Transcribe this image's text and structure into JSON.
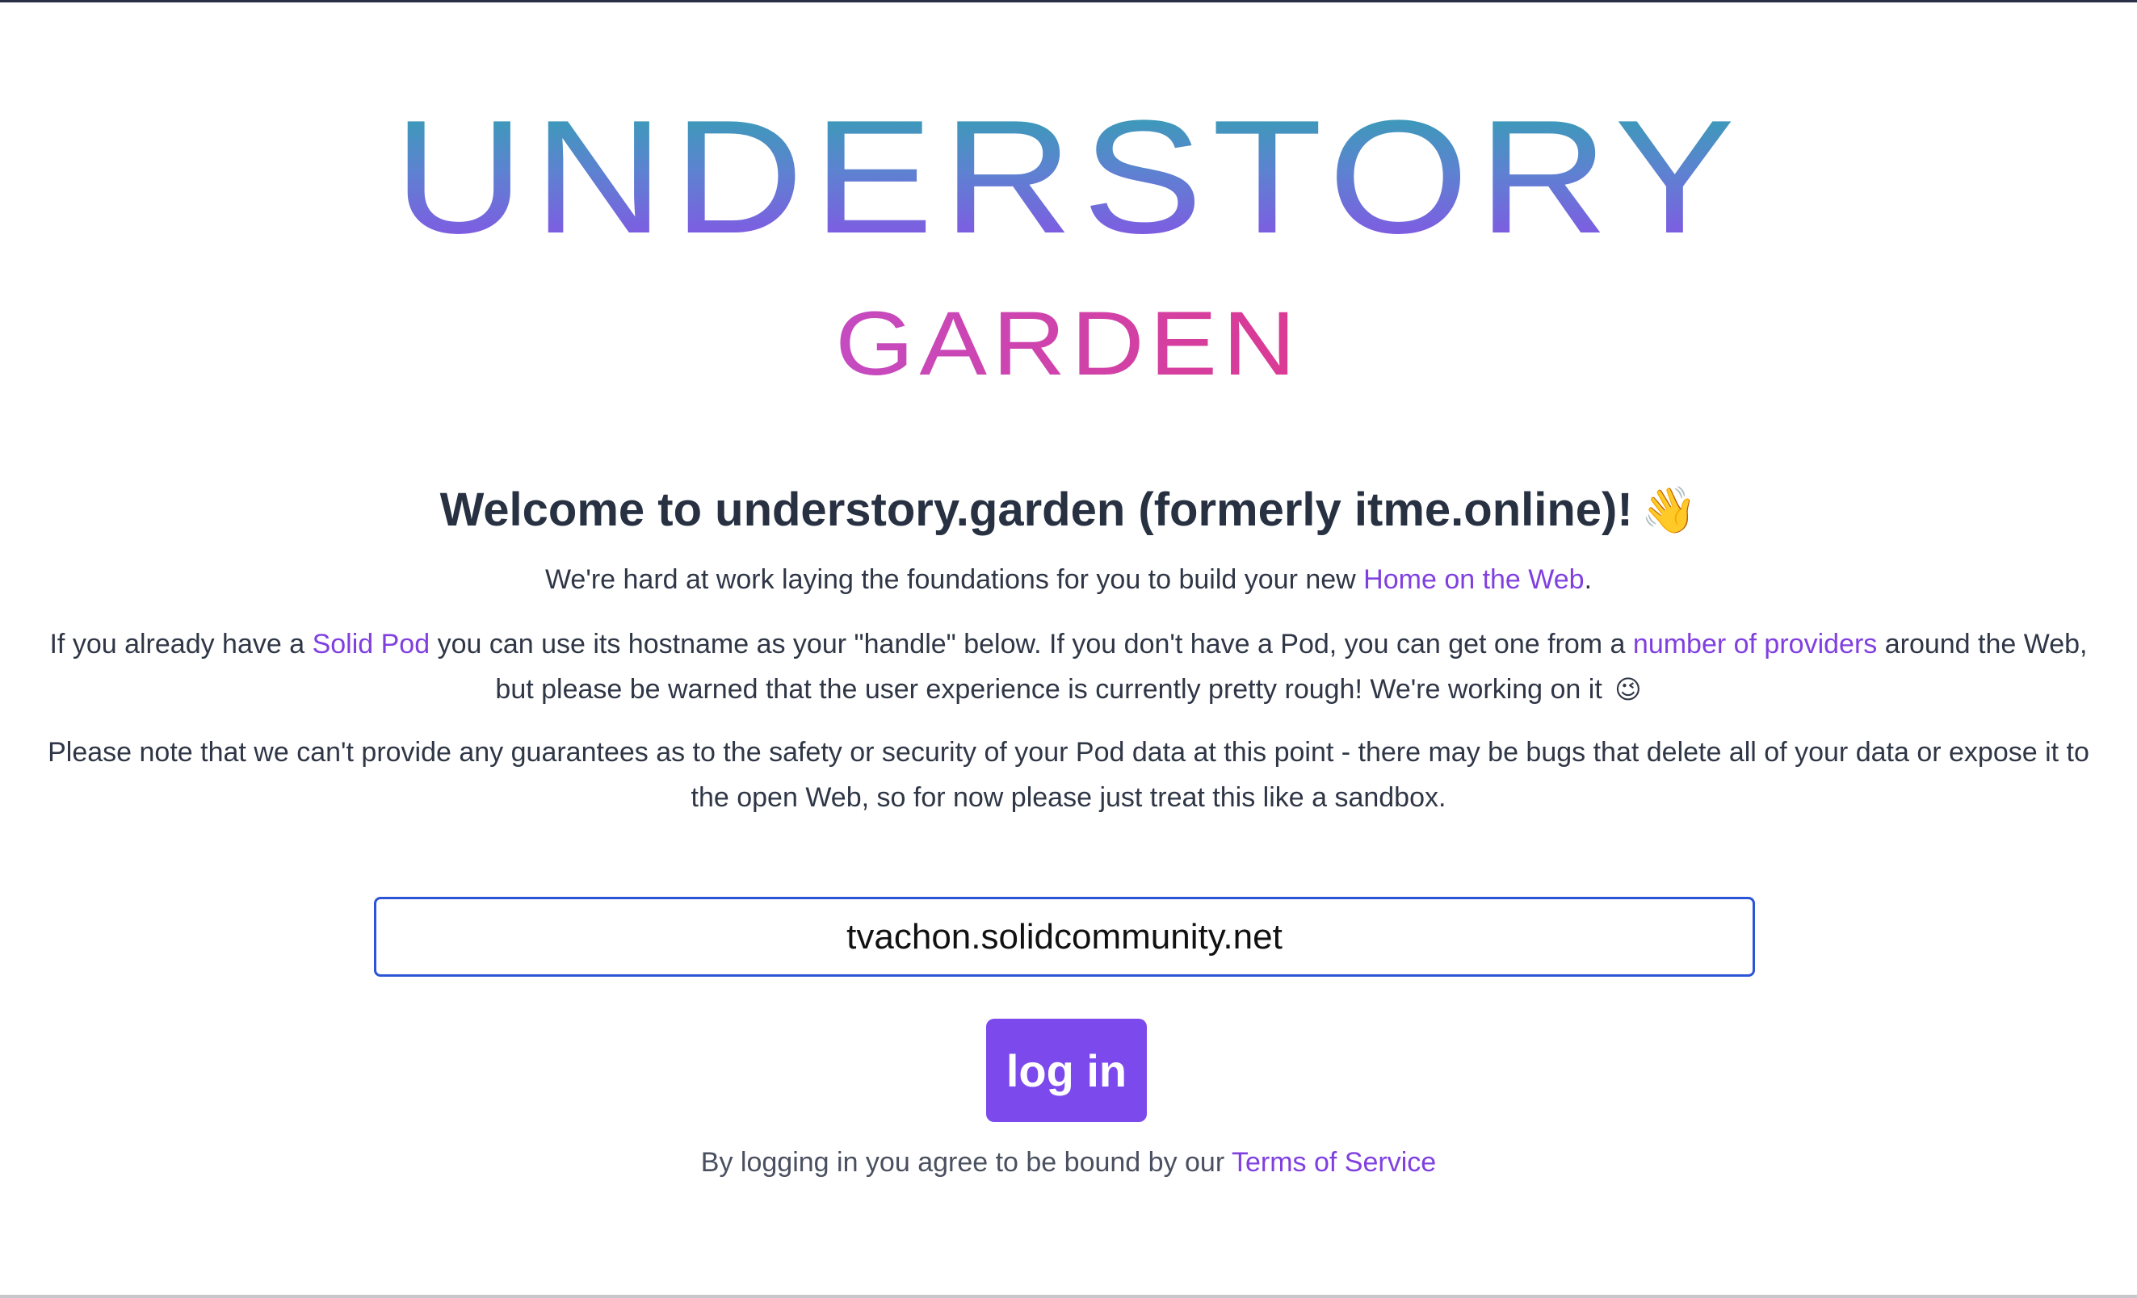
{
  "logo": {
    "title": "UNDERSTORY",
    "subtitle": "GARDEN"
  },
  "welcome": {
    "heading": "Welcome to understory.garden (formerly itme.online)!",
    "icon": "👋"
  },
  "intro": {
    "text_before": "We're hard at work laying the foundations for you to build your new ",
    "link": "Home on the Web",
    "text_after": "."
  },
  "pod_info": {
    "text_1": "If you already have a ",
    "link_solid_pod": "Solid Pod",
    "text_2": " you can use its hostname as your \"handle\" below. If you don't have a Pod, you can get one from a ",
    "link_providers": "number of providers",
    "text_3": " around the Web, but please be warned that the user experience is currently pretty rough! We're working on it ",
    "icon": "😉"
  },
  "warning": {
    "text": "Please note that we can't provide any guarantees as to the safety or security of your Pod data at this point - there may be bugs that delete all of your data or expose it to the open Web, so for now please just treat this like a sandbox."
  },
  "login": {
    "handle_value": "tvachon.solidcommunity.net",
    "button_label": "log in"
  },
  "terms": {
    "text": "By logging in you agree to be bound by our ",
    "link": "Terms of Service"
  },
  "colors": {
    "accent": "#7c4aec",
    "link": "#8040e0",
    "input_border": "#2b55d6"
  }
}
